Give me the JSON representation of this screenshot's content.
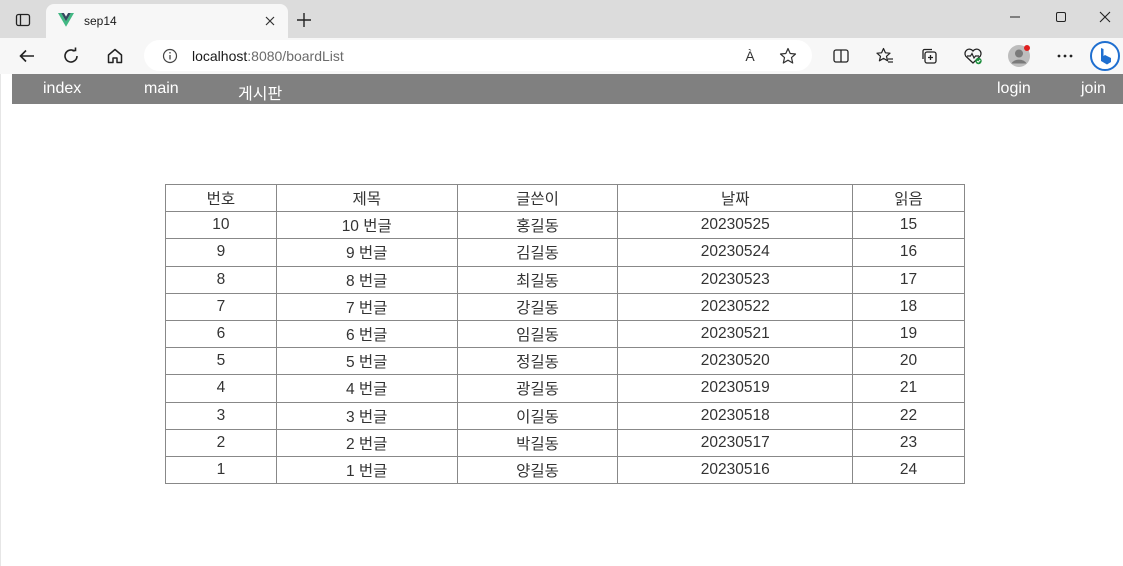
{
  "browser": {
    "tab_title": "sep14",
    "url_host": "localhost",
    "url_path": ":8080/boardList",
    "reader_label": "À",
    "tab_close_glyph": "✕",
    "new_tab_glyph": "+",
    "icons": [
      "tab-actions-icon",
      "vue-logo-icon",
      "close-icon",
      "plus-icon",
      "minimize-icon",
      "maximize-icon",
      "window-close-icon",
      "back-icon",
      "refresh-icon",
      "home-icon",
      "info-icon",
      "read-aloud-icon",
      "favorite-star-icon",
      "split-screen-icon",
      "favorites-icon",
      "collections-icon",
      "browser-essentials-icon",
      "profile-icon",
      "more-icon",
      "bing-icon"
    ]
  },
  "nav": {
    "left": [
      "index",
      "main",
      "게시판"
    ],
    "right": [
      "login",
      "join"
    ]
  },
  "board": {
    "headers": [
      "번호",
      "제목",
      "글쓴이",
      "날짜",
      "읽음"
    ],
    "rows": [
      [
        "10",
        "10 번글",
        "홍길동",
        "20230525",
        "15"
      ],
      [
        "9",
        "9 번글",
        "김길동",
        "20230524",
        "16"
      ],
      [
        "8",
        "8 번글",
        "최길동",
        "20230523",
        "17"
      ],
      [
        "7",
        "7 번글",
        "강길동",
        "20230522",
        "18"
      ],
      [
        "6",
        "6 번글",
        "임길동",
        "20230521",
        "19"
      ],
      [
        "5",
        "5 번글",
        "정길동",
        "20230520",
        "20"
      ],
      [
        "4",
        "4 번글",
        "광길동",
        "20230519",
        "21"
      ],
      [
        "3",
        "3 번글",
        "이길동",
        "20230518",
        "22"
      ],
      [
        "2",
        "2 번글",
        "박길동",
        "20230517",
        "23"
      ],
      [
        "1",
        "1 번글",
        "양길동",
        "20230516",
        "24"
      ]
    ]
  }
}
